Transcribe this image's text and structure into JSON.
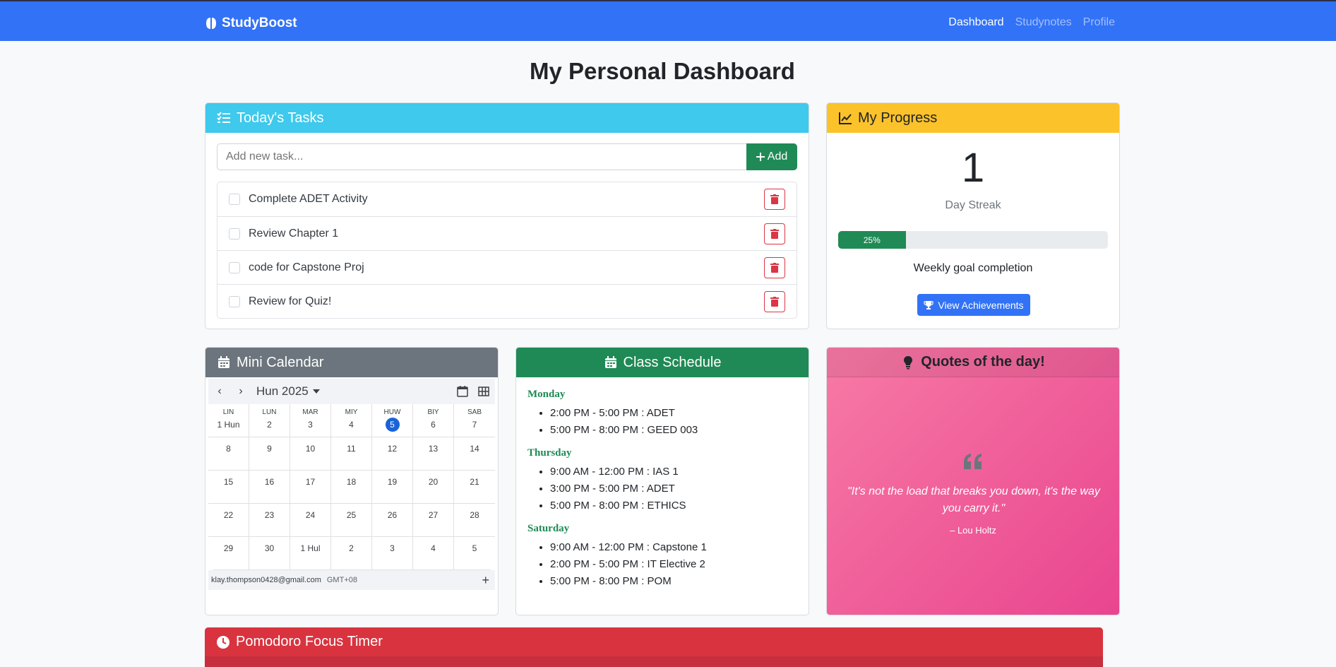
{
  "navbar": {
    "brand": "StudyBoost",
    "links": [
      {
        "label": "Dashboard",
        "active": true
      },
      {
        "label": "Studynotes",
        "active": false
      },
      {
        "label": "Profile",
        "active": false
      }
    ]
  },
  "page_title": "My Personal Dashboard",
  "tasks": {
    "title": "Today's Tasks",
    "input_placeholder": "Add new task...",
    "add_label": "Add",
    "items": [
      {
        "text": "Complete ADET Activity"
      },
      {
        "text": "Review Chapter 1"
      },
      {
        "text": "code for Capstone Proj"
      },
      {
        "text": "Review for Quiz!"
      }
    ]
  },
  "progress": {
    "title": "My Progress",
    "streak_value": "1",
    "streak_label": "Day Streak",
    "weekly_percent": 25,
    "weekly_percent_label": "25%",
    "weekly_label": "Weekly goal completion",
    "achievements_label": "View Achievements"
  },
  "calendar": {
    "title": "Mini Calendar",
    "month_label": "Hun 2025",
    "weekdays": [
      "LIN",
      "LUN",
      "MAR",
      "MIY",
      "HUW",
      "BIY",
      "SAB"
    ],
    "days": [
      "1 Hun",
      "2",
      "3",
      "4",
      "5",
      "6",
      "7",
      "8",
      "9",
      "10",
      "11",
      "12",
      "13",
      "14",
      "15",
      "16",
      "17",
      "18",
      "19",
      "20",
      "21",
      "22",
      "23",
      "24",
      "25",
      "26",
      "27",
      "28",
      "29",
      "30",
      "1 Hul",
      "2",
      "3",
      "4",
      "5"
    ],
    "today_index": 4,
    "account": "klay.thompson0428@gmail.com",
    "timezone": "GMT+08"
  },
  "schedule": {
    "title": "Class Schedule",
    "days": [
      {
        "day": "Monday",
        "classes": [
          "2:00 PM - 5:00 PM : ADET",
          "5:00 PM - 8:00 PM : GEED 003"
        ]
      },
      {
        "day": "Thursday",
        "classes": [
          "9:00 AM - 12:00 PM : IAS 1",
          "3:00 PM - 5:00 PM : ADET",
          "5:00 PM - 8:00 PM : ETHICS"
        ]
      },
      {
        "day": "Saturday",
        "classes": [
          "9:00 AM - 12:00 PM : Capstone 1",
          "2:00 PM - 5:00 PM : IT Elective 2",
          "5:00 PM - 8:00 PM : POM"
        ]
      }
    ]
  },
  "quotes": {
    "title": "Quotes of the day!",
    "text": "\"It's not the load that breaks you down, it's the way you carry it.\"",
    "author": "– Lou Holtz"
  },
  "pomodoro": {
    "title": "Pomodoro Focus Timer"
  },
  "colors": {
    "primary": "#3272f7",
    "info": "#3ec9ed",
    "warning": "#fcc22a",
    "success": "#1f8a55",
    "secondary": "#6c757d",
    "danger": "#d9333f"
  }
}
